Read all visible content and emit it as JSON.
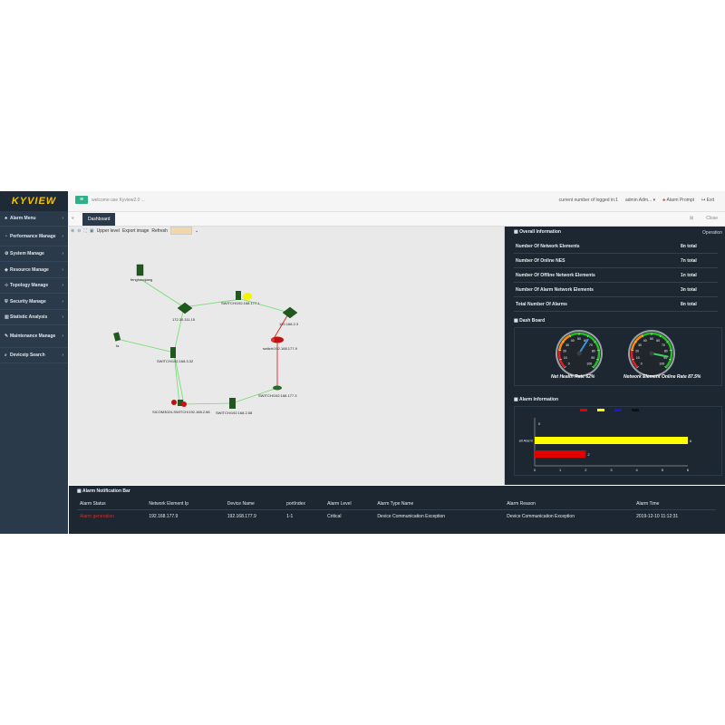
{
  "app": {
    "logo": "KYVIEW"
  },
  "header": {
    "welcome": "welcome use Kyview2.0 ...",
    "logged_in": "current number of logged in:1",
    "user": "admin Adm... ▾",
    "alarm_prompt": "Alarm Prompt",
    "exit": "Exit"
  },
  "sidebar": {
    "items": [
      {
        "label": "Alarm Menu",
        "icon": "bell-icon"
      },
      {
        "label": "Performance Manage",
        "icon": "gauge-icon"
      },
      {
        "label": "System Manage",
        "icon": "gear-icon"
      },
      {
        "label": "Resource Manage",
        "icon": "cube-icon"
      },
      {
        "label": "Topology Manage",
        "icon": "network-icon"
      },
      {
        "label": "Security Manage",
        "icon": "shield-icon"
      },
      {
        "label": "Statistic Analysis",
        "icon": "chart-icon"
      },
      {
        "label": "Maintenance Manage",
        "icon": "wrench-icon"
      },
      {
        "label": "Deviceip Search",
        "icon": "search-icon"
      }
    ]
  },
  "tabs": {
    "collapse": "«",
    "active": "Dashboard",
    "close_icon": "⊞",
    "close": "Close"
  },
  "map_toolbar": {
    "upper_level": "Upper level",
    "export_image": "Export image",
    "refresh": "Refresh"
  },
  "topology": {
    "nodes": [
      {
        "label": "fenghuoqiang"
      },
      {
        "label": "172.30.111.15"
      },
      {
        "label": "SWITCH/192.168.177.1"
      },
      {
        "label": "192.168.2.3"
      },
      {
        "label": "switch/192.168.177.9"
      },
      {
        "label": "fa"
      },
      {
        "label": "SWITCH/192.168.3.32"
      },
      {
        "label": "SICOM3024-SWITCH/192.168.2.66"
      },
      {
        "label": "SWITCH/192.168.2.58"
      },
      {
        "label": "SWITCH/192.168.177.3"
      }
    ]
  },
  "overview": {
    "operation": "Operation",
    "title": "Overall Information",
    "rows": [
      {
        "label": "Number Of Network Elements",
        "value": "8n total"
      },
      {
        "label": "Number Of Online NES",
        "value": "7n total"
      },
      {
        "label": "Number Of Offline Network Elements",
        "value": "1n total"
      },
      {
        "label": "Number Of Alarm Network Elements",
        "value": "3n total"
      },
      {
        "label": "Total Number Of Alarms",
        "value": "8n total"
      }
    ]
  },
  "dashboard": {
    "title": "Dash Board",
    "gauges": [
      {
        "label": "Net Health Rate 62%",
        "value": 62,
        "ticks": [
          "0",
          "10",
          "20",
          "30",
          "40",
          "50",
          "60",
          "70",
          "80",
          "90",
          "100"
        ]
      },
      {
        "label": "Network Element Online Rate 87.5%",
        "value": 87.5,
        "ticks": [
          "0",
          "10",
          "20",
          "30",
          "40",
          "50",
          "60",
          "70",
          "80",
          "90",
          "100"
        ]
      }
    ]
  },
  "alarm_info": {
    "title": "Alarm Information",
    "legend_colors": [
      "#e00000",
      "#ffff00",
      "#1a1ad6",
      "#111111"
    ]
  },
  "chart_data": {
    "type": "bar",
    "orientation": "horizontal",
    "categories": [
      "",
      "all Alarm",
      ""
    ],
    "values": [
      0,
      6,
      2
    ],
    "colors": [
      "#1a1ad6",
      "#ffff00",
      "#e00000"
    ],
    "xlim": [
      0,
      6
    ],
    "xticks": [
      "0",
      "1",
      "2",
      "3",
      "4",
      "5",
      "6"
    ],
    "value_labels": [
      "0",
      "6",
      "2"
    ]
  },
  "alarm_bar": {
    "title": "Alarm Notification Bar",
    "headers": [
      "Alarm Status",
      "Network Element Ip",
      "Device Name",
      "portIndex",
      "Alarm Level",
      "Alarm Type Name",
      "Alarm Reason",
      "Alarm Time"
    ],
    "rows": [
      [
        "Alarm generation",
        "192.168.177.9",
        "192.168.177.9",
        "1-1",
        "Critical",
        "Device Communication Exception",
        "Device Communication Exception",
        "2019-12-10 11:12:31"
      ]
    ]
  }
}
